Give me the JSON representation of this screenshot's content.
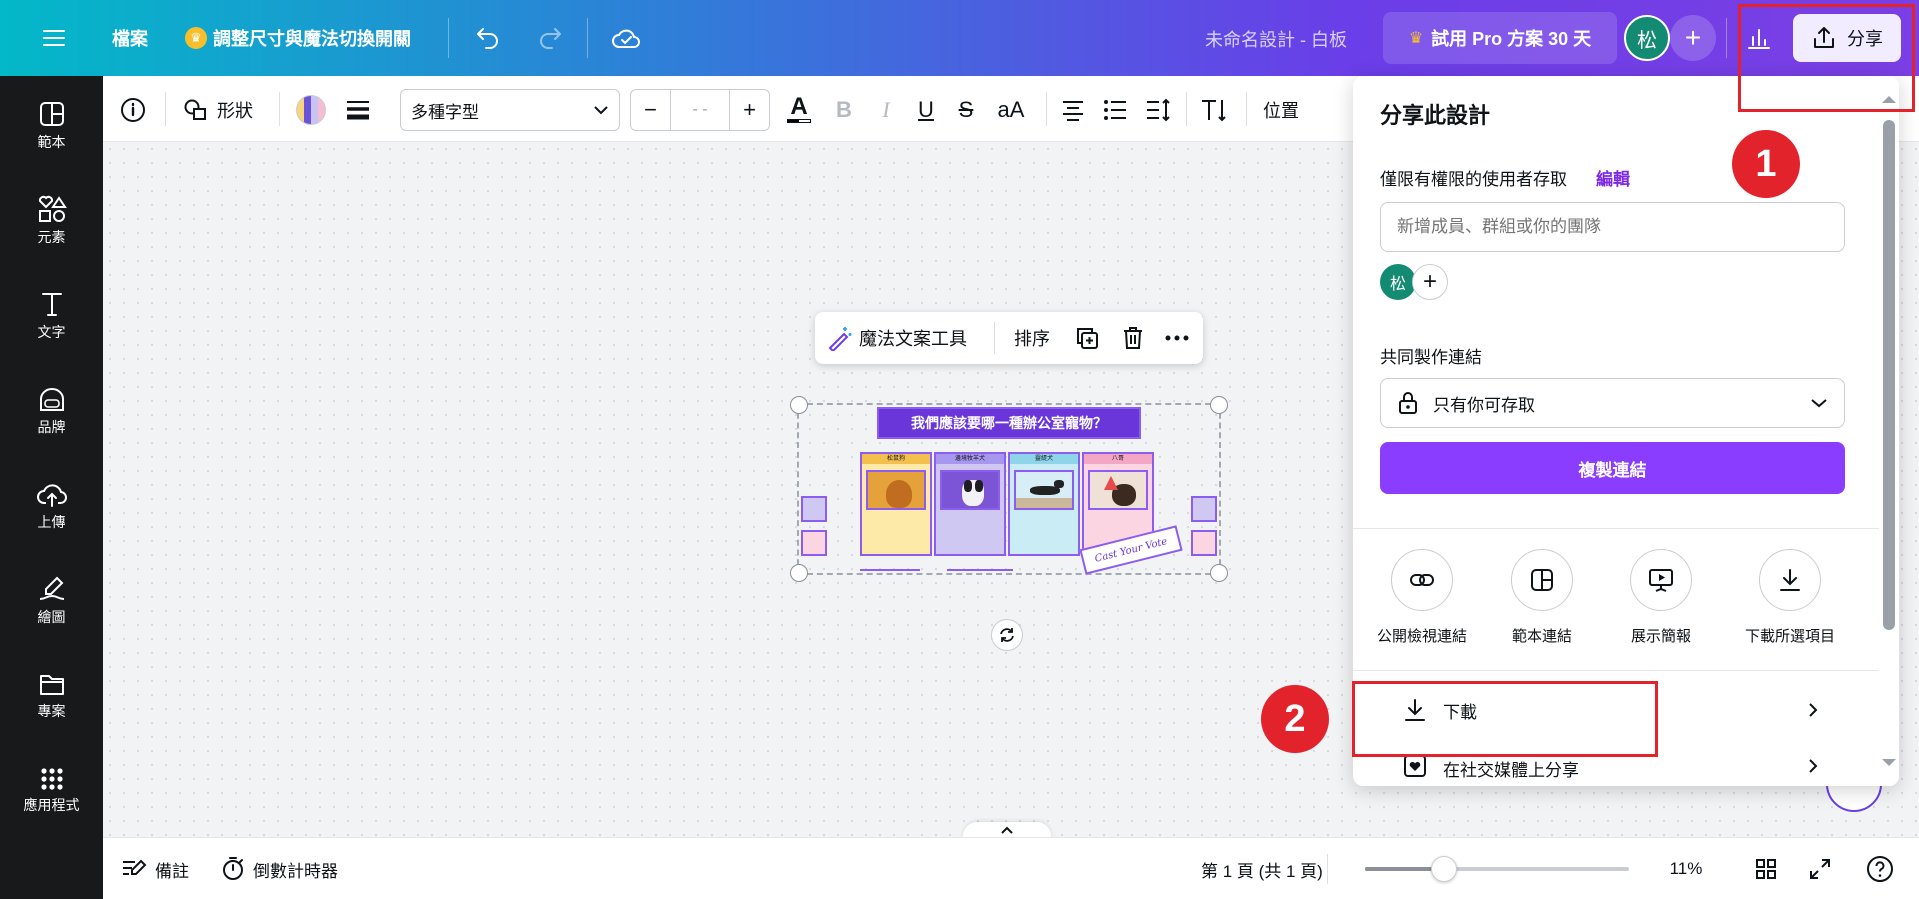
{
  "topbar": {
    "menu_icon": "hamburger-icon",
    "file_label": "檔案",
    "resize_label": "調整尺寸與魔法切換開關",
    "doc_title": "未命名設計 - 白板",
    "pro_trial_label": "試用 Pro 方案 30 天",
    "avatar_letter": "松",
    "share_label": "分享"
  },
  "sidebar": {
    "items": [
      {
        "label": "範本",
        "icon": "template-icon"
      },
      {
        "label": "元素",
        "icon": "elements-icon"
      },
      {
        "label": "文字",
        "icon": "text-icon"
      },
      {
        "label": "品牌",
        "icon": "brand-icon"
      },
      {
        "label": "上傳",
        "icon": "upload-icon"
      },
      {
        "label": "繪圖",
        "icon": "draw-icon"
      },
      {
        "label": "專案",
        "icon": "folder-icon"
      },
      {
        "label": "應用程式",
        "icon": "apps-icon"
      }
    ]
  },
  "toolbar": {
    "shape_label": "形狀",
    "font_label": "多種字型",
    "font_size": "- -",
    "case_label": "aA",
    "position_label": "位置"
  },
  "floating_toolbar": {
    "magic_write_label": "魔法文案工具",
    "arrange_label": "排序"
  },
  "design": {
    "title": "我們應該要哪一種辦公室寵物？",
    "columns": [
      "松鼠狗",
      "邊境牧羊犬",
      "靈緹犬",
      "八哥"
    ],
    "signature_text": "Cast Your Vote"
  },
  "share_panel": {
    "title": "分享此設計",
    "access_label": "僅限有權限的使用者存取",
    "edit_label": "編輯",
    "invite_placeholder": "新增成員、群組或你的團隊",
    "avatar_letter": "松",
    "collab_label": "共同製作連結",
    "collab_value": "只有你可存取",
    "copy_link_label": "複製連結",
    "actions": [
      {
        "label": "公開檢視連結",
        "icon": "link-icon"
      },
      {
        "label": "範本連結",
        "icon": "template-icon"
      },
      {
        "label": "展示簡報",
        "icon": "present-icon"
      },
      {
        "label": "下載所選項目",
        "icon": "download-icon"
      }
    ],
    "download_label": "下載",
    "social_label": "在社交媒體上分享"
  },
  "annotations": {
    "badge1": "1",
    "badge2": "2"
  },
  "bottombar": {
    "notes_label": "備註",
    "timer_label": "倒數計時器",
    "page_label": "第 1 頁 (共 1 頁)",
    "zoom": "11%",
    "zoom_fraction": 0.1
  },
  "colors": {
    "accent": "#8b3dff",
    "annotation_red": "#e3232c",
    "sidebar_bg": "#18191b"
  }
}
